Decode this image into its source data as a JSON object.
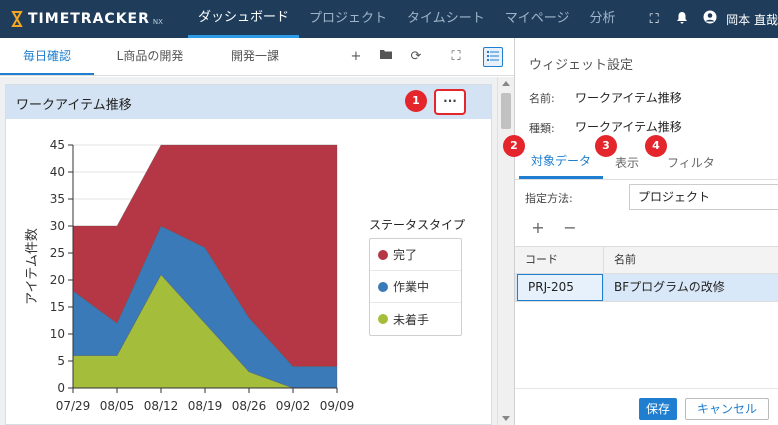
{
  "app": {
    "logo_text": "TIMETRACKER",
    "logo_sub": "NX"
  },
  "nav": {
    "items": [
      "ダッシュボード",
      "プロジェクト",
      "タイムシート",
      "マイページ",
      "分析"
    ],
    "active": 0
  },
  "user": {
    "name": "岡本 直哉"
  },
  "tabs": {
    "items": [
      "毎日確認",
      "L商品の開発",
      "開発一課"
    ],
    "active": 0
  },
  "widget": {
    "title": "ワークアイテム推移",
    "more_label": "···"
  },
  "badges": [
    "1",
    "2",
    "3",
    "4"
  ],
  "chart_data": {
    "type": "area",
    "stacked": true,
    "x": [
      "07/29",
      "08/05",
      "08/12",
      "08/19",
      "08/26",
      "09/02",
      "09/09"
    ],
    "ylabel": "アイテム件数",
    "ylim": [
      0,
      45
    ],
    "yticks": [
      0,
      5,
      10,
      15,
      20,
      25,
      30,
      35,
      40,
      45
    ],
    "legend_title": "ステータスタイプ",
    "legend_position": "right",
    "series": [
      {
        "name": "未着手",
        "color": "#a4be3c",
        "values": [
          6,
          6,
          21,
          12,
          3,
          0,
          0
        ]
      },
      {
        "name": "作業中",
        "color": "#3a7ab8",
        "values": [
          12,
          6,
          9,
          14,
          10,
          4,
          4
        ]
      },
      {
        "name": "完了",
        "color": "#b53645",
        "values": [
          12,
          18,
          15,
          19,
          32,
          41,
          41
        ]
      }
    ]
  },
  "settings": {
    "title": "ウィジェット設定",
    "name_label": "名前:",
    "name_value": "ワークアイテム推移",
    "type_label": "種類:",
    "type_value": "ワークアイテム推移",
    "tabs": [
      "対象データ",
      "表示",
      "フィルタ"
    ],
    "active_tab": 0,
    "method_label": "指定方法:",
    "method_value": "プロジェクト",
    "add_label": "+",
    "remove_label": "−",
    "columns": [
      "コード",
      "名前"
    ],
    "rows": [
      {
        "code": "PRJ-205",
        "name": "BFプログラムの改修"
      }
    ],
    "save_label": "保存",
    "cancel_label": "キャンセル"
  }
}
